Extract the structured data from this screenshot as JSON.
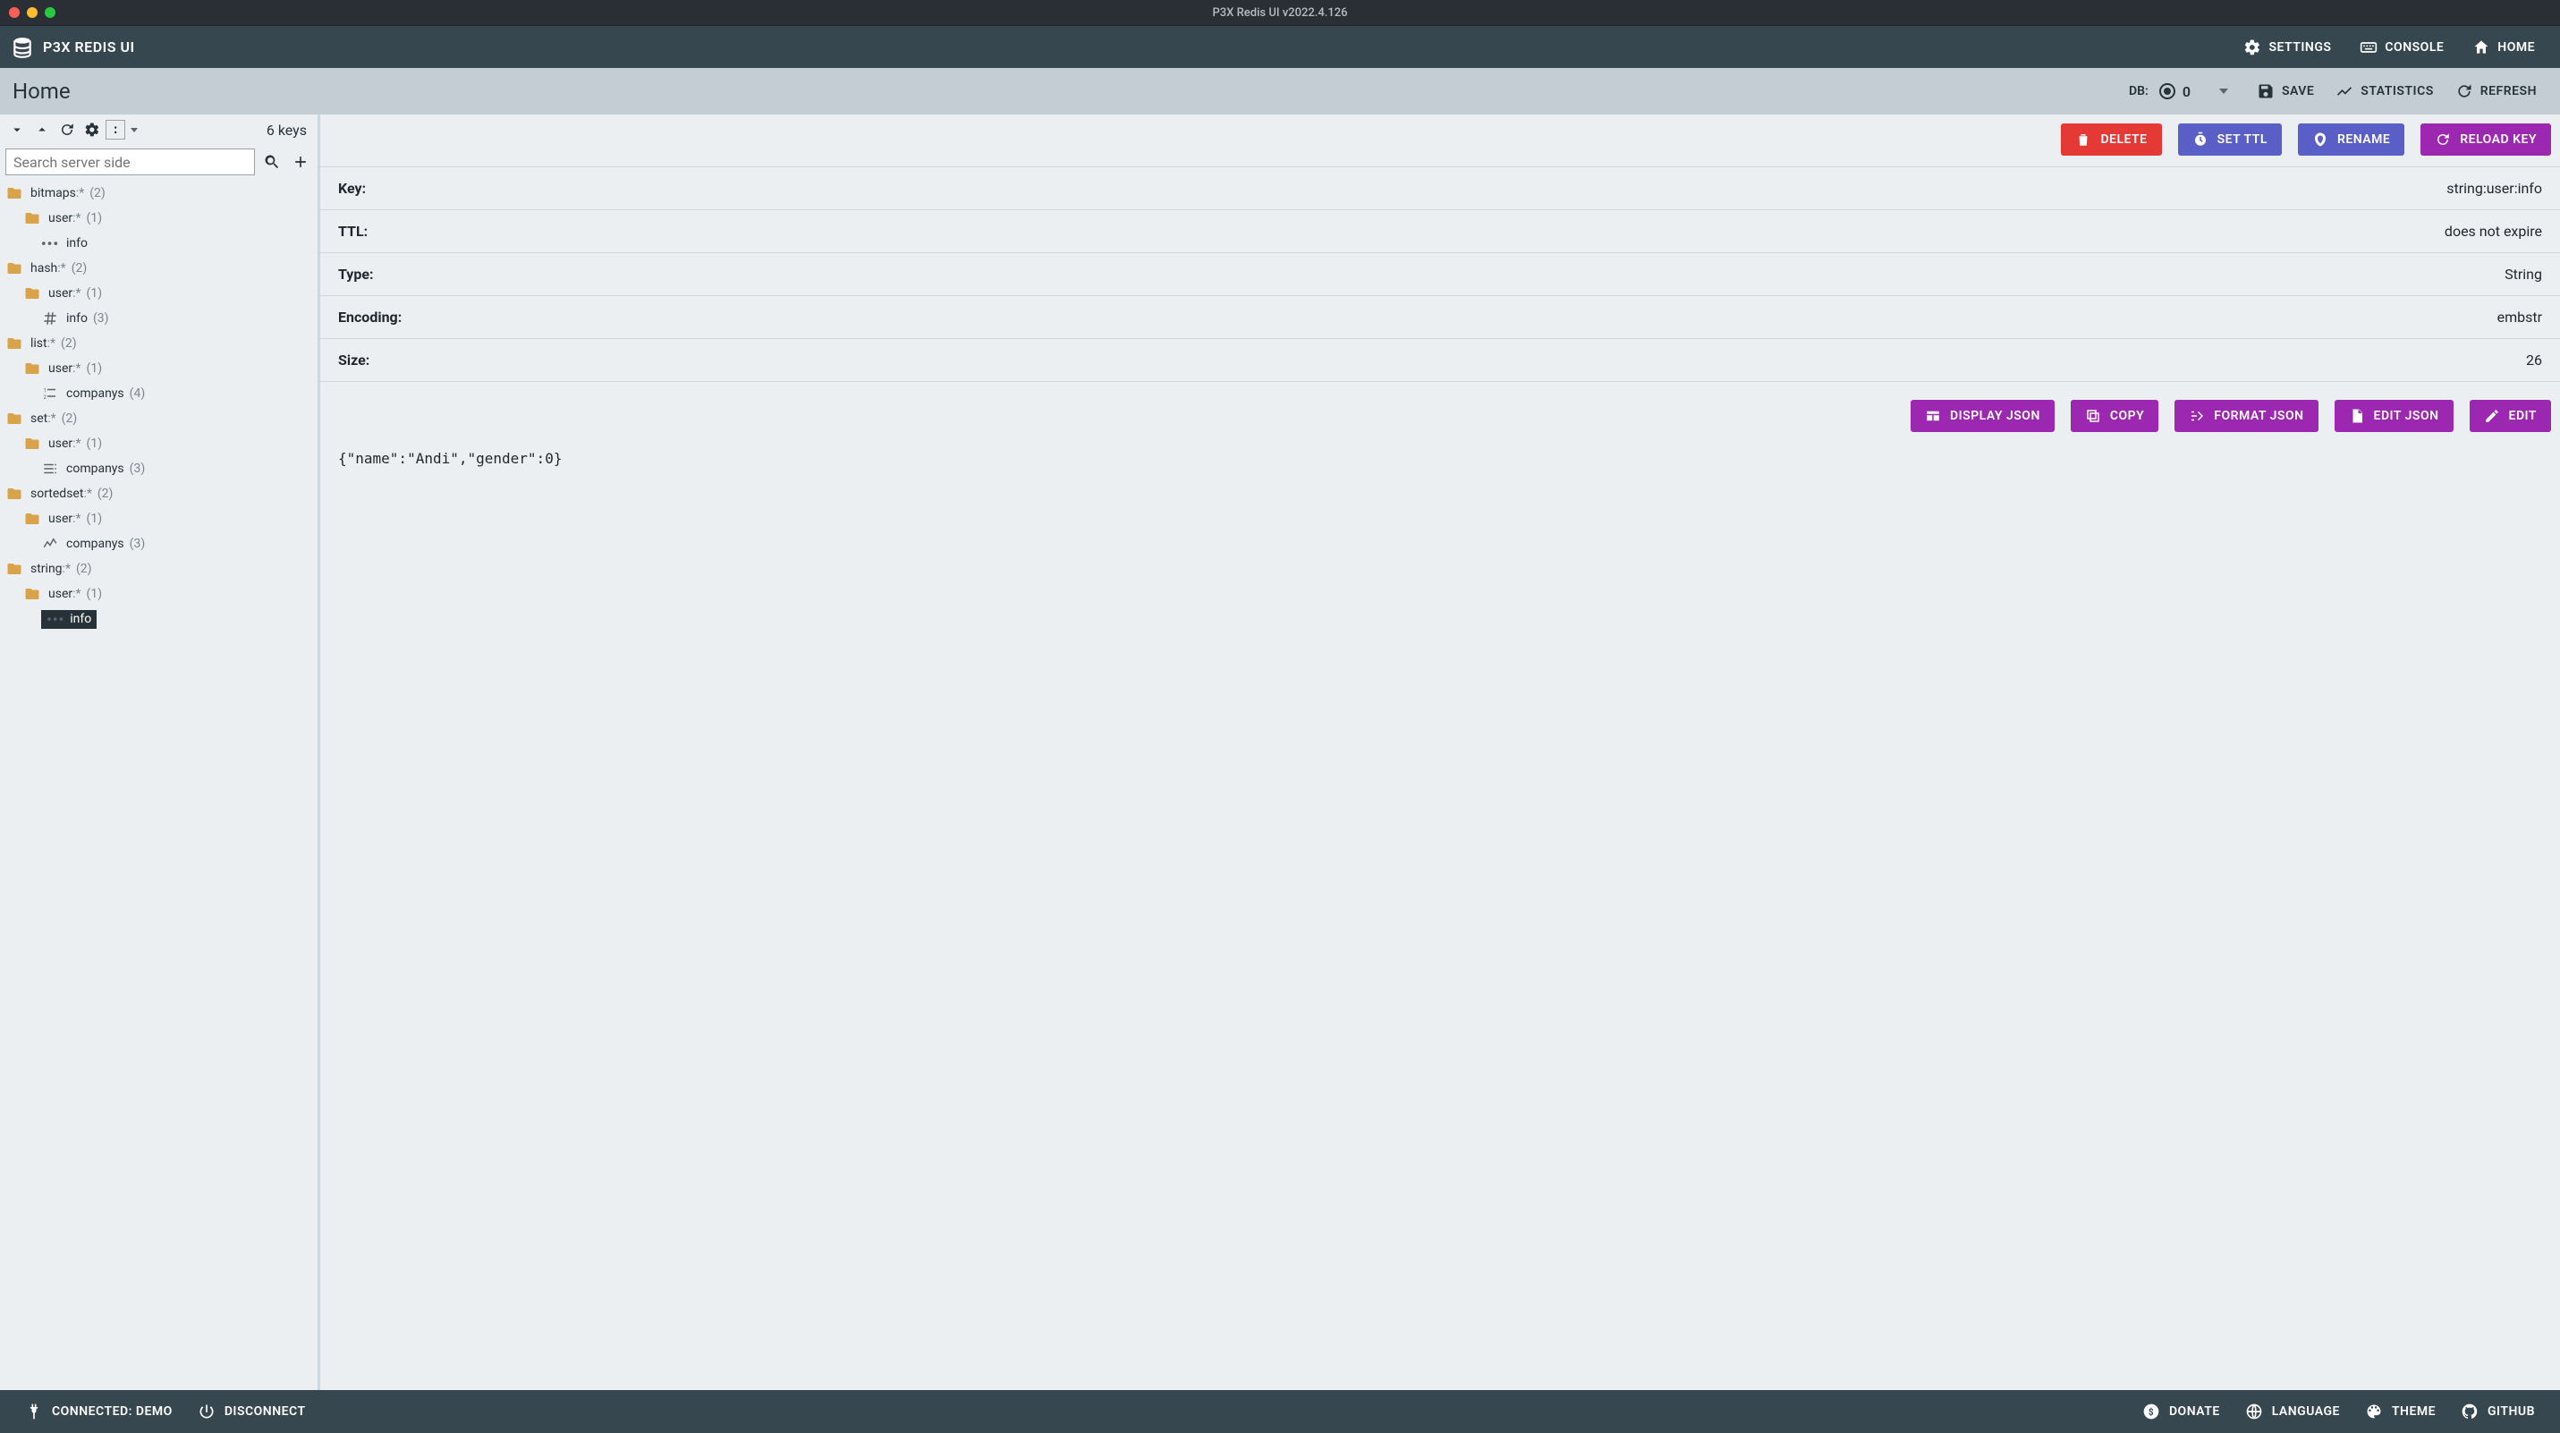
{
  "window": {
    "title": "P3X Redis UI v2022.4.126"
  },
  "header": {
    "brand": "P3X REDIS UI",
    "settings": "SETTINGS",
    "console": "CONSOLE",
    "home": "HOME"
  },
  "subbar": {
    "title": "Home",
    "db_label": "DB:",
    "db_value": "0",
    "save": "SAVE",
    "statistics": "STATISTICS",
    "refresh": "REFRESH"
  },
  "sidebar": {
    "keys_count": "6 keys",
    "search_placeholder": "Search server side",
    "separator": ":",
    "tree": [
      {
        "depth": 0,
        "type": "folder",
        "name": "bitmaps",
        "suffix": ":*",
        "count": "(2)"
      },
      {
        "depth": 1,
        "type": "folder",
        "name": "user",
        "suffix": ":*",
        "count": "(1)"
      },
      {
        "depth": 2,
        "type": "leaf-dots",
        "name": "info"
      },
      {
        "depth": 0,
        "type": "folder",
        "name": "hash",
        "suffix": ":*",
        "count": "(2)"
      },
      {
        "depth": 1,
        "type": "folder",
        "name": "user",
        "suffix": ":*",
        "count": "(1)"
      },
      {
        "depth": 2,
        "type": "leaf-hash",
        "name": "info",
        "count": "(3)"
      },
      {
        "depth": 0,
        "type": "folder",
        "name": "list",
        "suffix": ":*",
        "count": "(2)"
      },
      {
        "depth": 1,
        "type": "folder",
        "name": "user",
        "suffix": ":*",
        "count": "(1)"
      },
      {
        "depth": 2,
        "type": "leaf-list",
        "name": "companys",
        "count": "(4)"
      },
      {
        "depth": 0,
        "type": "folder",
        "name": "set",
        "suffix": ":*",
        "count": "(2)"
      },
      {
        "depth": 1,
        "type": "folder",
        "name": "user",
        "suffix": ":*",
        "count": "(1)"
      },
      {
        "depth": 2,
        "type": "leaf-set",
        "name": "companys",
        "count": "(3)"
      },
      {
        "depth": 0,
        "type": "folder",
        "name": "sortedset",
        "suffix": ":*",
        "count": "(2)"
      },
      {
        "depth": 1,
        "type": "folder",
        "name": "user",
        "suffix": ":*",
        "count": "(1)"
      },
      {
        "depth": 2,
        "type": "leaf-sorted",
        "name": "companys",
        "count": "(3)"
      },
      {
        "depth": 0,
        "type": "folder",
        "name": "string",
        "suffix": ":*",
        "count": "(2)"
      },
      {
        "depth": 1,
        "type": "folder",
        "name": "user",
        "suffix": ":*",
        "count": "(1)"
      },
      {
        "depth": 2,
        "type": "leaf-dots",
        "name": "info",
        "selected": true
      }
    ]
  },
  "actions": {
    "delete": "DELETE",
    "set_ttl": "SET TTL",
    "rename": "RENAME",
    "reload_key": "RELOAD KEY"
  },
  "details": {
    "rows": [
      {
        "k": "Key:",
        "v": "string:user:info"
      },
      {
        "k": "TTL:",
        "v": "does not expire"
      },
      {
        "k": "Type:",
        "v": "String"
      },
      {
        "k": "Encoding:",
        "v": "embstr"
      },
      {
        "k": "Size:",
        "v": "26"
      }
    ]
  },
  "value_actions": {
    "display_json": "DISPLAY JSON",
    "copy": "COPY",
    "format_json": "FORMAT JSON",
    "edit_json": "EDIT JSON",
    "edit": "EDIT"
  },
  "value_body": "{\"name\":\"Andi\",\"gender\":0}",
  "footer": {
    "connected": "CONNECTED: DEMO",
    "disconnect": "DISCONNECT",
    "donate": "DONATE",
    "language": "LANGUAGE",
    "theme": "THEME",
    "github": "GITHUB"
  }
}
